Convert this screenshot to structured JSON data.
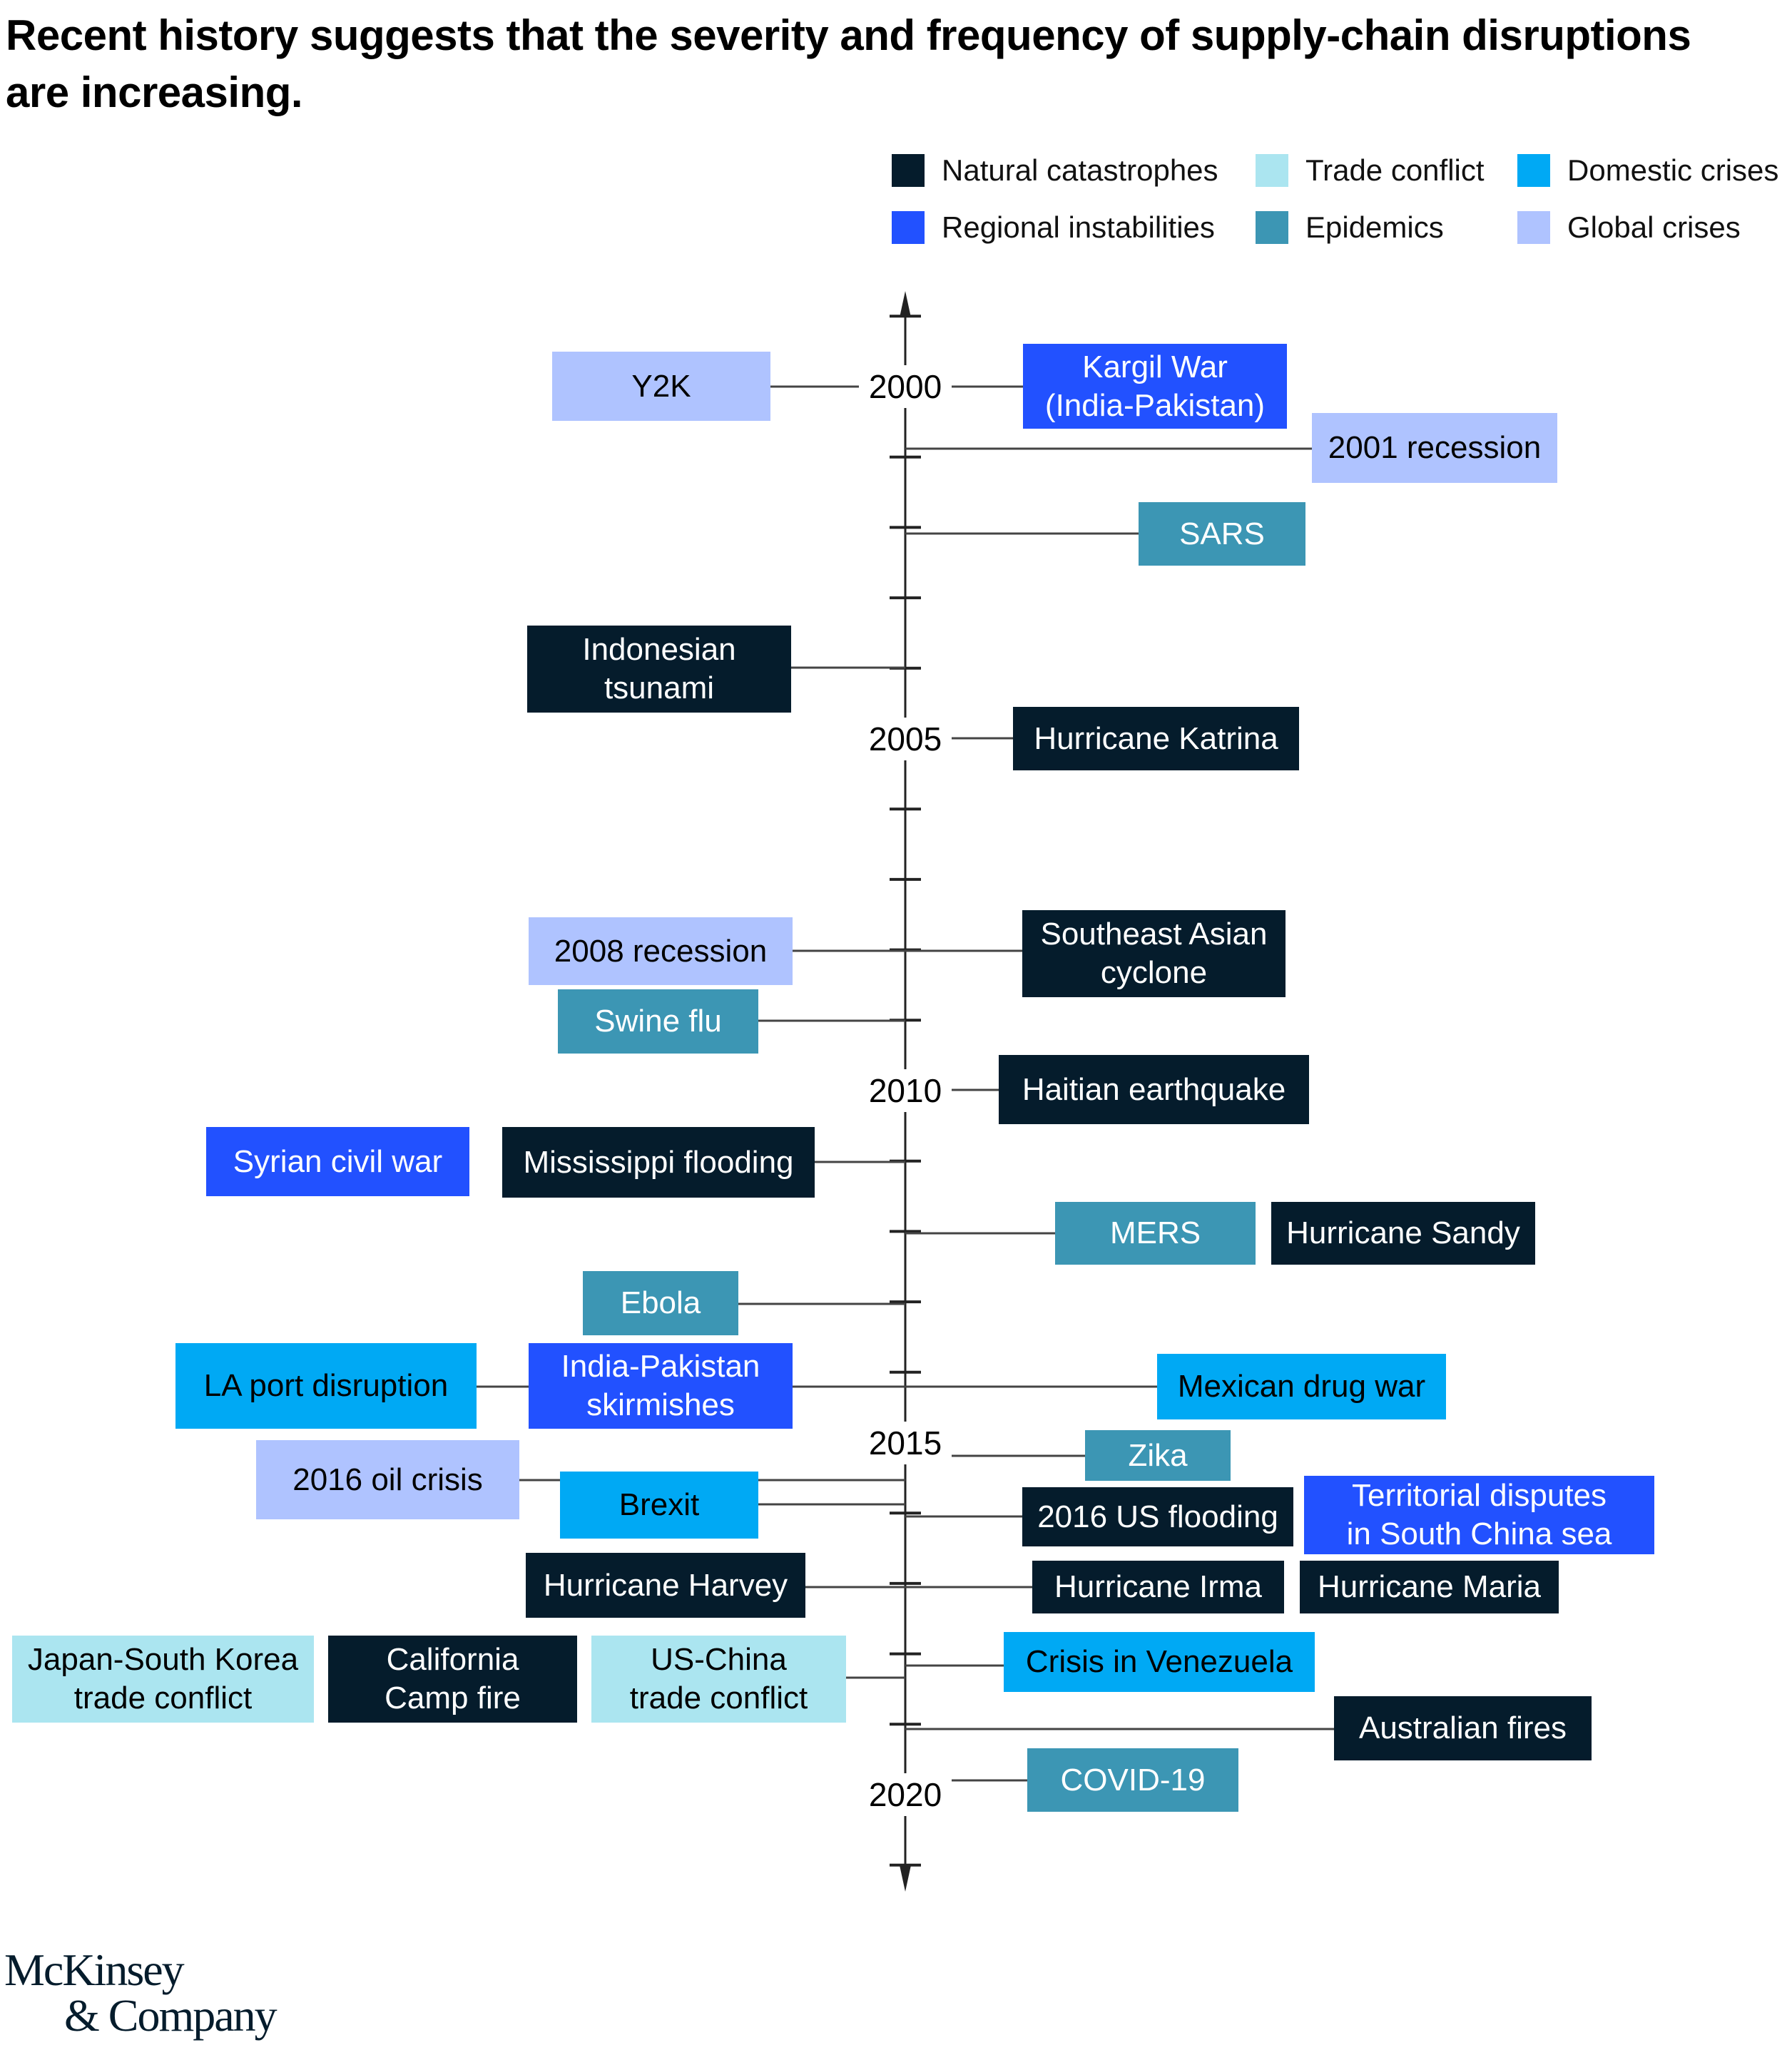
{
  "title": "Recent history suggests that the severity and frequency of supply-chain disruptions are increasing.",
  "legend": [
    {
      "key": "natural",
      "label": "Natural catastrophes",
      "color": "#051c2c"
    },
    {
      "key": "trade",
      "label": "Trade conflict",
      "color": "#abe5f0"
    },
    {
      "key": "domestic",
      "label": "Domestic crises",
      "color": "#00a9f4"
    },
    {
      "key": "regional",
      "label": "Regional instabilities",
      "color": "#2251ff"
    },
    {
      "key": "epidemic",
      "label": "Epidemics",
      "color": "#3c96b4"
    },
    {
      "key": "global",
      "label": "Global crises",
      "color": "#afc3ff"
    }
  ],
  "axis": {
    "year_labels": [
      "2000",
      "2005",
      "2010",
      "2015",
      "2020"
    ],
    "start_year": 1999,
    "end_year": 2021
  },
  "events": [
    {
      "label": "Y2K",
      "category": "global",
      "text_color": "#000000"
    },
    {
      "label": "Kargil War\n(India-Pakistan)",
      "category": "regional",
      "text_color": "#ffffff"
    },
    {
      "label": "2001 recession",
      "category": "global",
      "text_color": "#000000"
    },
    {
      "label": "SARS",
      "category": "epidemic",
      "text_color": "#ffffff"
    },
    {
      "label": "Indonesian\ntsunami",
      "category": "natural",
      "text_color": "#ffffff"
    },
    {
      "label": "Hurricane Katrina",
      "category": "natural",
      "text_color": "#ffffff"
    },
    {
      "label": "2008 recession",
      "category": "global",
      "text_color": "#000000"
    },
    {
      "label": "Southeast Asian\ncyclone",
      "category": "natural",
      "text_color": "#ffffff"
    },
    {
      "label": "Swine flu",
      "category": "epidemic",
      "text_color": "#ffffff"
    },
    {
      "label": "Haitian earthquake",
      "category": "natural",
      "text_color": "#ffffff"
    },
    {
      "label": "Syrian civil war",
      "category": "regional",
      "text_color": "#ffffff"
    },
    {
      "label": "Mississippi flooding",
      "category": "natural",
      "text_color": "#ffffff"
    },
    {
      "label": "MERS",
      "category": "epidemic",
      "text_color": "#ffffff"
    },
    {
      "label": "Hurricane Sandy",
      "category": "natural",
      "text_color": "#ffffff"
    },
    {
      "label": "Ebola",
      "category": "epidemic",
      "text_color": "#ffffff"
    },
    {
      "label": "LA port disruption",
      "category": "domestic",
      "text_color": "#000000"
    },
    {
      "label": "India-Pakistan\nskirmishes",
      "category": "regional",
      "text_color": "#ffffff"
    },
    {
      "label": "Mexican drug war",
      "category": "domestic",
      "text_color": "#000000"
    },
    {
      "label": "Zika",
      "category": "epidemic",
      "text_color": "#ffffff"
    },
    {
      "label": "2016 oil crisis",
      "category": "global",
      "text_color": "#000000"
    },
    {
      "label": "Brexit",
      "category": "domestic",
      "text_color": "#000000"
    },
    {
      "label": "2016 US flooding",
      "category": "natural",
      "text_color": "#ffffff"
    },
    {
      "label": "Territorial disputes\nin South China sea",
      "category": "regional",
      "text_color": "#ffffff"
    },
    {
      "label": "Hurricane Harvey",
      "category": "natural",
      "text_color": "#ffffff"
    },
    {
      "label": "Hurricane Irma",
      "category": "natural",
      "text_color": "#ffffff"
    },
    {
      "label": "Hurricane Maria",
      "category": "natural",
      "text_color": "#ffffff"
    },
    {
      "label": "Japan-South Korea\ntrade conflict",
      "category": "trade",
      "text_color": "#000000"
    },
    {
      "label": "California\nCamp fire",
      "category": "natural",
      "text_color": "#ffffff"
    },
    {
      "label": "US-China\ntrade conflict",
      "category": "trade",
      "text_color": "#000000"
    },
    {
      "label": "Crisis in Venezuela",
      "category": "domestic",
      "text_color": "#000000"
    },
    {
      "label": "Australian fires",
      "category": "natural",
      "text_color": "#ffffff"
    },
    {
      "label": "COVID-19",
      "category": "epidemic",
      "text_color": "#ffffff"
    }
  ],
  "logo": {
    "line1": "McKinsey",
    "line2": "& Company"
  }
}
